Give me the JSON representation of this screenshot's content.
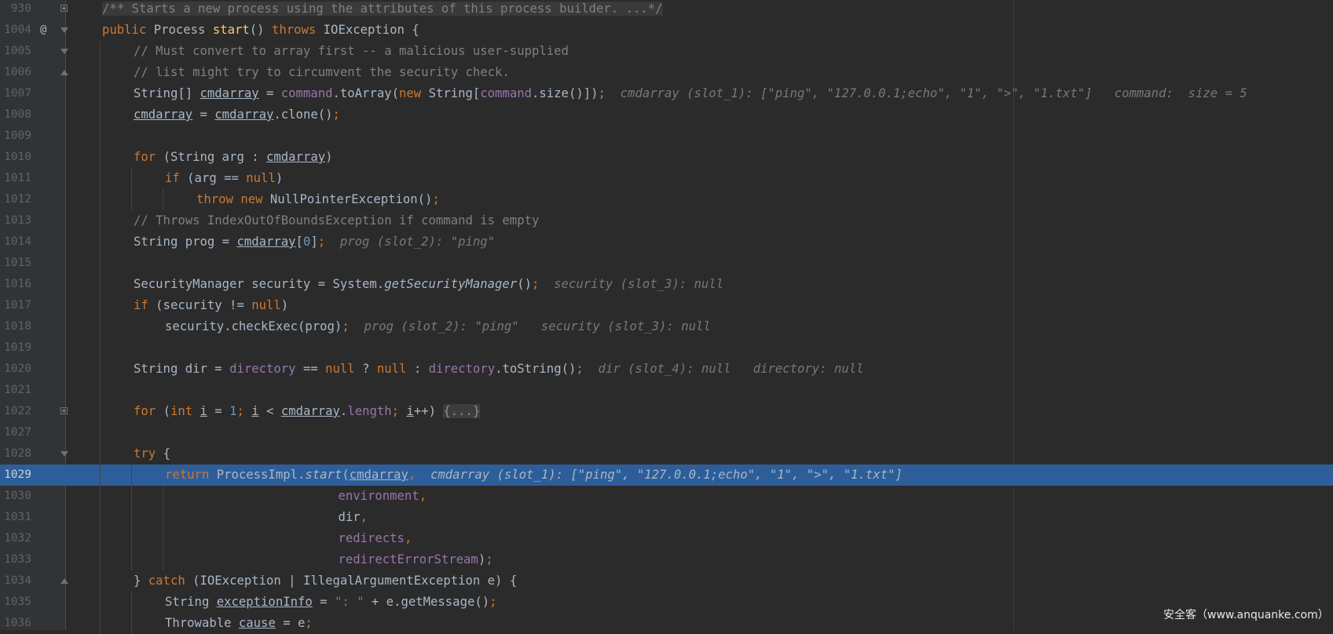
{
  "watermark": "安全客（www.anquanke.com）",
  "lines": [
    {
      "num": "930",
      "marker": "",
      "fold": "plus",
      "indent": 0,
      "tokens": [
        {
          "t": "/** Starts a new process using the attributes of this process builder. ...*/",
          "c": "c doc-bg"
        }
      ]
    },
    {
      "num": "1004",
      "marker": "@",
      "fold": "open",
      "indent": 0,
      "tokens": [
        {
          "t": "public ",
          "c": "k"
        },
        {
          "t": "Process "
        },
        {
          "t": "start",
          "c": "mt"
        },
        {
          "t": "() "
        },
        {
          "t": "throws ",
          "c": "k"
        },
        {
          "t": "IOException {"
        }
      ]
    },
    {
      "num": "1005",
      "marker": "",
      "fold": "open",
      "indent": 1,
      "tokens": [
        {
          "t": "// Must convert to array first -- a malicious user-supplied",
          "c": "c"
        }
      ]
    },
    {
      "num": "1006",
      "marker": "",
      "fold": "close",
      "indent": 1,
      "tokens": [
        {
          "t": "// list might try to circumvent the security check.",
          "c": "c"
        }
      ]
    },
    {
      "num": "1007",
      "marker": "",
      "fold": "",
      "indent": 1,
      "tokens": [
        {
          "t": "String[] "
        },
        {
          "t": "cmdarray",
          "c": "u"
        },
        {
          "t": " = "
        },
        {
          "t": "command",
          "c": "f"
        },
        {
          "t": ".toArray("
        },
        {
          "t": "new ",
          "c": "k"
        },
        {
          "t": "String["
        },
        {
          "t": "command",
          "c": "f"
        },
        {
          "t": ".size()])"
        },
        {
          "t": ";",
          "c": "k"
        },
        {
          "t": "  cmdarray (slot_1): [\"ping\", \"127.0.0.1;echo\", \"1\", \">\", \"1.txt\"]   command:  size = 5",
          "c": "hint"
        }
      ]
    },
    {
      "num": "1008",
      "marker": "",
      "fold": "",
      "indent": 1,
      "tokens": [
        {
          "t": "cmdarray",
          "c": "u"
        },
        {
          "t": " = "
        },
        {
          "t": "cmdarray",
          "c": "u"
        },
        {
          "t": ".clone()"
        },
        {
          "t": ";",
          "c": "k"
        }
      ]
    },
    {
      "num": "1009",
      "marker": "",
      "fold": "",
      "indent": 0,
      "tokens": []
    },
    {
      "num": "1010",
      "marker": "",
      "fold": "",
      "indent": 1,
      "tokens": [
        {
          "t": "for ",
          "c": "k"
        },
        {
          "t": "(String arg : "
        },
        {
          "t": "cmdarray",
          "c": "u"
        },
        {
          "t": ")"
        }
      ]
    },
    {
      "num": "1011",
      "marker": "",
      "fold": "",
      "indent": 2,
      "tokens": [
        {
          "t": "if ",
          "c": "k"
        },
        {
          "t": "(arg == "
        },
        {
          "t": "null",
          "c": "k"
        },
        {
          "t": ")"
        }
      ]
    },
    {
      "num": "1012",
      "marker": "",
      "fold": "",
      "indent": 3,
      "tokens": [
        {
          "t": "throw new ",
          "c": "k"
        },
        {
          "t": "NullPointerException()"
        },
        {
          "t": ";",
          "c": "k"
        }
      ]
    },
    {
      "num": "1013",
      "marker": "",
      "fold": "",
      "indent": 1,
      "tokens": [
        {
          "t": "// Throws IndexOutOfBoundsException if command is empty",
          "c": "c"
        }
      ]
    },
    {
      "num": "1014",
      "marker": "",
      "fold": "",
      "indent": 1,
      "tokens": [
        {
          "t": "String prog = "
        },
        {
          "t": "cmdarray",
          "c": "u"
        },
        {
          "t": "["
        },
        {
          "t": "0",
          "c": "n"
        },
        {
          "t": "]"
        },
        {
          "t": ";",
          "c": "k"
        },
        {
          "t": "  prog (slot_2): \"ping\"",
          "c": "hint"
        }
      ]
    },
    {
      "num": "1015",
      "marker": "",
      "fold": "",
      "indent": 0,
      "tokens": []
    },
    {
      "num": "1016",
      "marker": "",
      "fold": "",
      "indent": 1,
      "tokens": [
        {
          "t": "SecurityManager security = System."
        },
        {
          "t": "getSecurityManager",
          "c": "mi"
        },
        {
          "t": "()"
        },
        {
          "t": ";",
          "c": "k"
        },
        {
          "t": "  security (slot_3): null",
          "c": "hint"
        }
      ]
    },
    {
      "num": "1017",
      "marker": "",
      "fold": "",
      "indent": 1,
      "tokens": [
        {
          "t": "if ",
          "c": "k"
        },
        {
          "t": "(security != "
        },
        {
          "t": "null",
          "c": "k"
        },
        {
          "t": ")"
        }
      ]
    },
    {
      "num": "1018",
      "marker": "",
      "fold": "",
      "indent": 2,
      "tokens": [
        {
          "t": "security.checkExec(prog)"
        },
        {
          "t": ";",
          "c": "k"
        },
        {
          "t": "  prog (slot_2): \"ping\"   security (slot_3): null",
          "c": "hint"
        }
      ]
    },
    {
      "num": "1019",
      "marker": "",
      "fold": "",
      "indent": 0,
      "tokens": []
    },
    {
      "num": "1020",
      "marker": "",
      "fold": "",
      "indent": 1,
      "tokens": [
        {
          "t": "String dir = "
        },
        {
          "t": "directory",
          "c": "f"
        },
        {
          "t": " == "
        },
        {
          "t": "null ",
          "c": "k"
        },
        {
          "t": "? "
        },
        {
          "t": "null ",
          "c": "k"
        },
        {
          "t": ": "
        },
        {
          "t": "directory",
          "c": "f"
        },
        {
          "t": ".toString()"
        },
        {
          "t": ";",
          "c": "k"
        },
        {
          "t": "  dir (slot_4): null   directory: null",
          "c": "hint"
        }
      ]
    },
    {
      "num": "1021",
      "marker": "",
      "fold": "",
      "indent": 0,
      "tokens": []
    },
    {
      "num": "1022",
      "marker": "",
      "fold": "plus",
      "indent": 1,
      "tokens": [
        {
          "t": "for ",
          "c": "k"
        },
        {
          "t": "("
        },
        {
          "t": "int ",
          "c": "k"
        },
        {
          "t": "i",
          "c": "u"
        },
        {
          "t": " = "
        },
        {
          "t": "1",
          "c": "n"
        },
        {
          "t": "; ",
          "c": "k"
        },
        {
          "t": "i",
          "c": "u"
        },
        {
          "t": " < "
        },
        {
          "t": "cmdarray",
          "c": "u"
        },
        {
          "t": "."
        },
        {
          "t": "length",
          "c": "f"
        },
        {
          "t": "; ",
          "c": "k"
        },
        {
          "t": "i",
          "c": "u"
        },
        {
          "t": "++) "
        },
        {
          "t": "{...}",
          "c": "folded"
        }
      ]
    },
    {
      "num": "1027",
      "marker": "",
      "fold": "",
      "indent": 0,
      "tokens": []
    },
    {
      "num": "1028",
      "marker": "",
      "fold": "open",
      "indent": 1,
      "tokens": [
        {
          "t": "try ",
          "c": "k"
        },
        {
          "t": "{"
        }
      ]
    },
    {
      "num": "1029",
      "marker": "",
      "fold": "",
      "indent": 2,
      "exec": true,
      "tokens": [
        {
          "t": "return ",
          "c": "k"
        },
        {
          "t": "ProcessImpl."
        },
        {
          "t": "start",
          "c": "mi"
        },
        {
          "t": "("
        },
        {
          "t": "cmdarray",
          "c": "u"
        },
        {
          "t": ",",
          "c": "k"
        },
        {
          "t": "  cmdarray (slot_1): [\"ping\", \"127.0.0.1;echo\", \"1\", \">\", \"1.txt\"]",
          "c": "hint"
        }
      ]
    },
    {
      "num": "1030",
      "marker": "",
      "fold": "",
      "indent": 0,
      "pad": "                                ",
      "tokens": [
        {
          "t": "environment",
          "c": "f"
        },
        {
          "t": ",",
          "c": "k"
        }
      ]
    },
    {
      "num": "1031",
      "marker": "",
      "fold": "",
      "indent": 0,
      "pad": "                                ",
      "tokens": [
        {
          "t": "dir"
        },
        {
          "t": ",",
          "c": "k"
        }
      ]
    },
    {
      "num": "1032",
      "marker": "",
      "fold": "",
      "indent": 0,
      "pad": "                                ",
      "tokens": [
        {
          "t": "redirects",
          "c": "f"
        },
        {
          "t": ",",
          "c": "k"
        }
      ]
    },
    {
      "num": "1033",
      "marker": "",
      "fold": "",
      "indent": 0,
      "pad": "                                ",
      "tokens": [
        {
          "t": "redirectErrorStream",
          "c": "f"
        },
        {
          "t": ")"
        },
        {
          "t": ";",
          "c": "k"
        }
      ]
    },
    {
      "num": "1034",
      "marker": "",
      "fold": "close",
      "indent": 1,
      "tokens": [
        {
          "t": "} "
        },
        {
          "t": "catch ",
          "c": "k"
        },
        {
          "t": "(IOException | IllegalArgumentException e) {"
        }
      ]
    },
    {
      "num": "1035",
      "marker": "",
      "fold": "",
      "indent": 2,
      "tokens": [
        {
          "t": "String "
        },
        {
          "t": "exceptionInfo",
          "c": "u"
        },
        {
          "t": " = "
        },
        {
          "t": "\": \"",
          "c": "s"
        },
        {
          "t": " + e.getMessage()"
        },
        {
          "t": ";",
          "c": "k"
        }
      ]
    },
    {
      "num": "1036",
      "marker": "",
      "fold": "",
      "indent": 2,
      "tokens": [
        {
          "t": "Throwable "
        },
        {
          "t": "cause",
          "c": "u"
        },
        {
          "t": " = e"
        },
        {
          "t": ";",
          "c": "k"
        }
      ]
    }
  ]
}
